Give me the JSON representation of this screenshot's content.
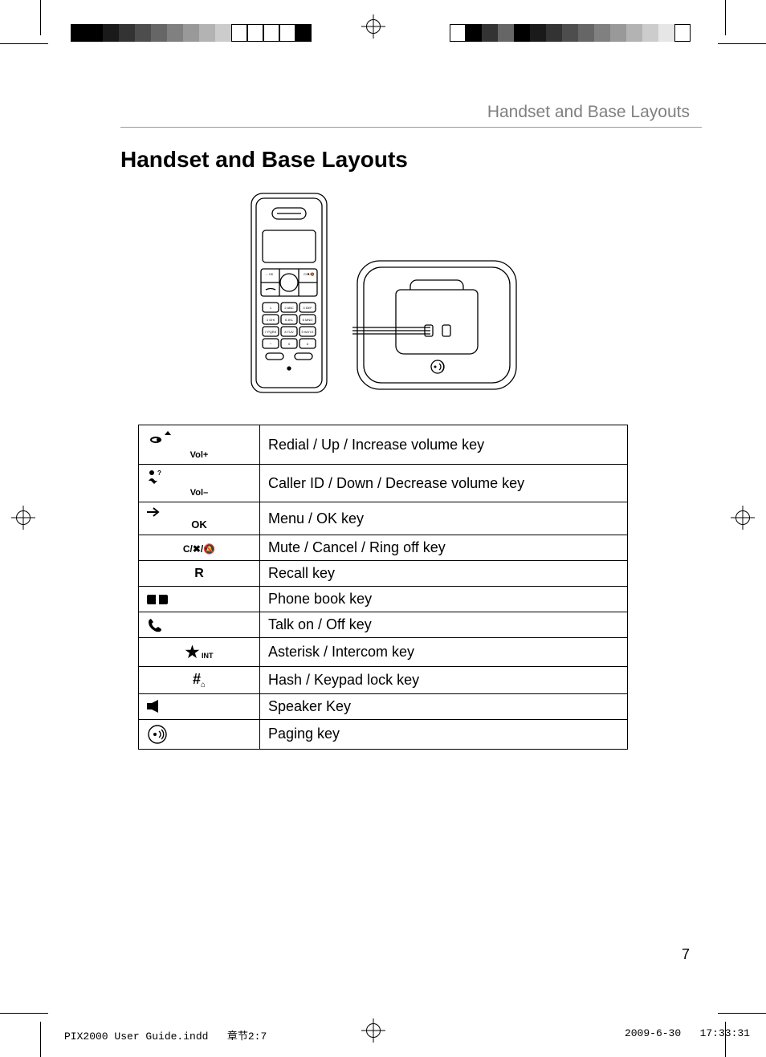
{
  "header": {
    "running_head": "Handset and Base Layouts"
  },
  "title": "Handset and Base Layouts",
  "key_table": [
    {
      "symbol_text": "Vol+",
      "icon": "redial-up",
      "desc": "Redial / Up / Increase volume key"
    },
    {
      "symbol_text": "Vol–",
      "icon": "callerid-down",
      "desc": "Caller ID / Down / Decrease volume key"
    },
    {
      "symbol_text": "OK",
      "icon": "arrow-ok",
      "desc": "Menu / OK key"
    },
    {
      "symbol_text": "C/✖/🔕",
      "icon": "cancel",
      "desc": "Mute / Cancel / Ring off key"
    },
    {
      "symbol_text": "R",
      "icon": "recall",
      "desc": "Recall key"
    },
    {
      "symbol_text": "",
      "icon": "phonebook",
      "desc": "Phone book key"
    },
    {
      "symbol_text": "",
      "icon": "talk",
      "desc": "Talk on / Off key"
    },
    {
      "symbol_text": "★ INT",
      "icon": "asterisk",
      "desc": "Asterisk / Intercom key"
    },
    {
      "symbol_text": "# ⌐",
      "icon": "hash",
      "desc": "Hash / Keypad lock key"
    },
    {
      "symbol_text": "",
      "icon": "speaker",
      "desc": "Speaker Key"
    },
    {
      "symbol_text": "",
      "icon": "paging",
      "desc": "Paging key"
    }
  ],
  "page_number": "7",
  "slug": {
    "file": "PIX2000 User Guide.indd",
    "section": "章节2:7",
    "date": "2009-6-30",
    "time": "17:33:31"
  },
  "keypad_labels": [
    "1",
    "2 ABC",
    "3 DEF",
    "4 GHI",
    "5 JKL",
    "6 MNO",
    "7 PQRS",
    "8 TUV",
    "9 WXYZ",
    "*",
    "0",
    "#"
  ]
}
